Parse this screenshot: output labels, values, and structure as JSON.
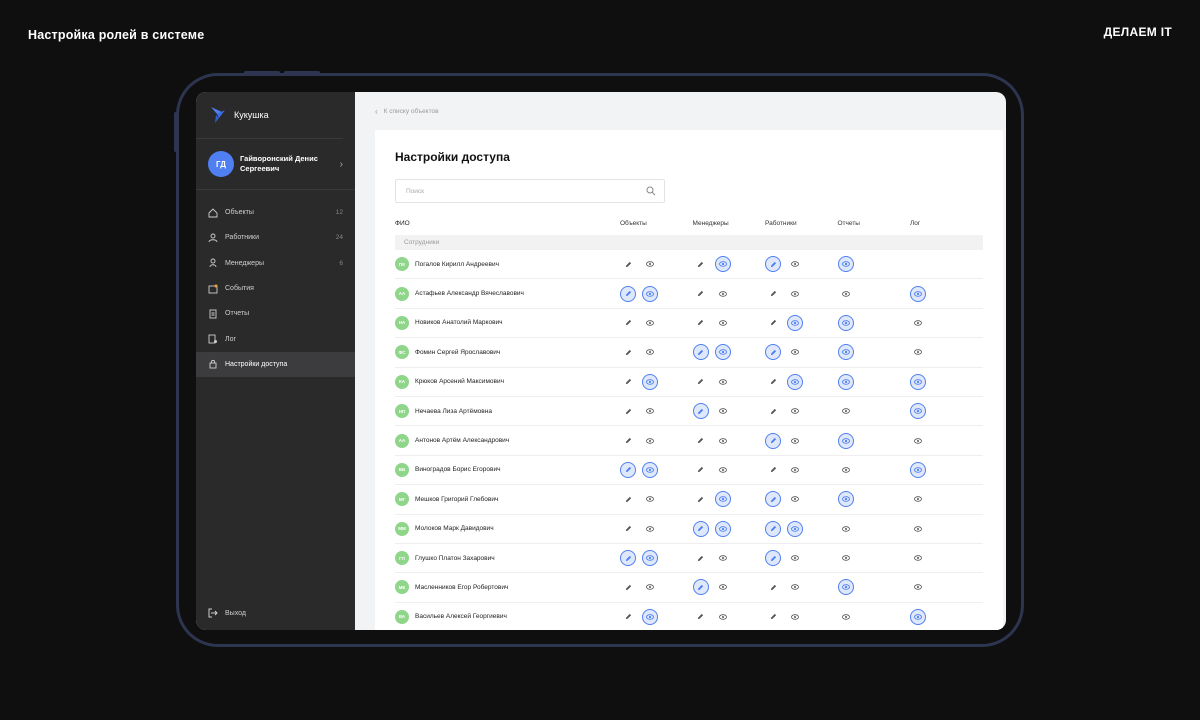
{
  "slide_title": "Настройка ролей в системе",
  "brand": "ДЕЛАЕМ IT",
  "app": {
    "name": "Кукушка",
    "user": {
      "initials": "ГД",
      "name": "Гайворонский Денис Сергеевич"
    },
    "nav": [
      {
        "label": "Объекты",
        "count": "12",
        "icon": "home-icon"
      },
      {
        "label": "Работники",
        "count": "24",
        "icon": "workers-icon"
      },
      {
        "label": "Менеджеры",
        "count": "6",
        "icon": "manager-icon"
      },
      {
        "label": "События",
        "count": "",
        "icon": "events-icon"
      },
      {
        "label": "Отчеты",
        "count": "",
        "icon": "report-icon"
      },
      {
        "label": "Лог",
        "count": "",
        "icon": "log-icon"
      },
      {
        "label": "Настройки доступа",
        "count": "",
        "icon": "lock-icon",
        "active": true
      }
    ],
    "logout": "Выход"
  },
  "breadcrumb": "К списку объектов",
  "page_title": "Настройки доступа",
  "search_placeholder": "Поиск",
  "columns": [
    "ФИО",
    "Объекты",
    "Менеджеры",
    "Работники",
    "Отчеты",
    "Лог"
  ],
  "group_label": "Сотрудники",
  "colors": {
    "accent": "#4f7ff0",
    "avatar_green": "#8fd68b",
    "sidebar": "#2a2a2b"
  },
  "rows": [
    {
      "initials": "ПК",
      "name": "Погалов Кирилл Андреевич",
      "perms": [
        [
          0,
          0
        ],
        [
          0,
          1
        ],
        [
          1,
          0
        ],
        [
          1
        ]
      ]
    },
    {
      "initials": "АА",
      "name": "Астафьев Александр Вячеславович",
      "perms": [
        [
          1,
          1
        ],
        [
          0,
          0
        ],
        [
          0,
          0
        ],
        [
          0
        ],
        [
          1
        ]
      ]
    },
    {
      "initials": "НА",
      "name": "Новиков Анатолий Маркович",
      "perms": [
        [
          0,
          0
        ],
        [
          0,
          0
        ],
        [
          0,
          1
        ],
        [
          1
        ],
        [
          0
        ]
      ]
    },
    {
      "initials": "ФС",
      "name": "Фомин Сергей Ярославович",
      "perms": [
        [
          0,
          0
        ],
        [
          1,
          1
        ],
        [
          1,
          0
        ],
        [
          1
        ],
        [
          0
        ]
      ]
    },
    {
      "initials": "КА",
      "name": "Крюков Арсений Максимович",
      "perms": [
        [
          0,
          1
        ],
        [
          0,
          0
        ],
        [
          0,
          1
        ],
        [
          1
        ],
        [
          1
        ]
      ]
    },
    {
      "initials": "НП",
      "name": "Нечаева Лиза Артёмовна",
      "perms": [
        [
          0,
          0
        ],
        [
          1,
          0
        ],
        [
          0,
          0
        ],
        [
          0
        ],
        [
          1
        ]
      ]
    },
    {
      "initials": "АА",
      "name": "Антонов Артём Александрович",
      "perms": [
        [
          0,
          0
        ],
        [
          0,
          0
        ],
        [
          1,
          0
        ],
        [
          1
        ],
        [
          0
        ]
      ]
    },
    {
      "initials": "ВБ",
      "name": "Виноградов Борис Егорович",
      "perms": [
        [
          1,
          1
        ],
        [
          0,
          0
        ],
        [
          0,
          0
        ],
        [
          0
        ],
        [
          1
        ]
      ]
    },
    {
      "initials": "МГ",
      "name": "Мешков Григорий Глебович",
      "perms": [
        [
          0,
          0
        ],
        [
          0,
          1
        ],
        [
          1,
          0
        ],
        [
          1
        ],
        [
          0
        ]
      ]
    },
    {
      "initials": "ММ",
      "name": "Молоков Марк Давидович",
      "perms": [
        [
          0,
          0
        ],
        [
          1,
          1
        ],
        [
          1,
          1
        ],
        [
          0
        ],
        [
          0
        ]
      ]
    },
    {
      "initials": "ГП",
      "name": "Глушко Платон Захарович",
      "perms": [
        [
          1,
          1
        ],
        [
          0,
          0
        ],
        [
          1,
          0
        ],
        [
          0
        ],
        [
          0
        ]
      ]
    },
    {
      "initials": "МЕ",
      "name": "Масленников Егор Робертович",
      "perms": [
        [
          0,
          0
        ],
        [
          1,
          0
        ],
        [
          0,
          0
        ],
        [
          1
        ],
        [
          0
        ]
      ]
    },
    {
      "initials": "ВА",
      "name": "Васильев Алексей Георгиевич",
      "perms": [
        [
          0,
          1
        ],
        [
          0,
          0
        ],
        [
          0,
          0
        ],
        [
          0
        ],
        [
          1
        ]
      ]
    }
  ]
}
